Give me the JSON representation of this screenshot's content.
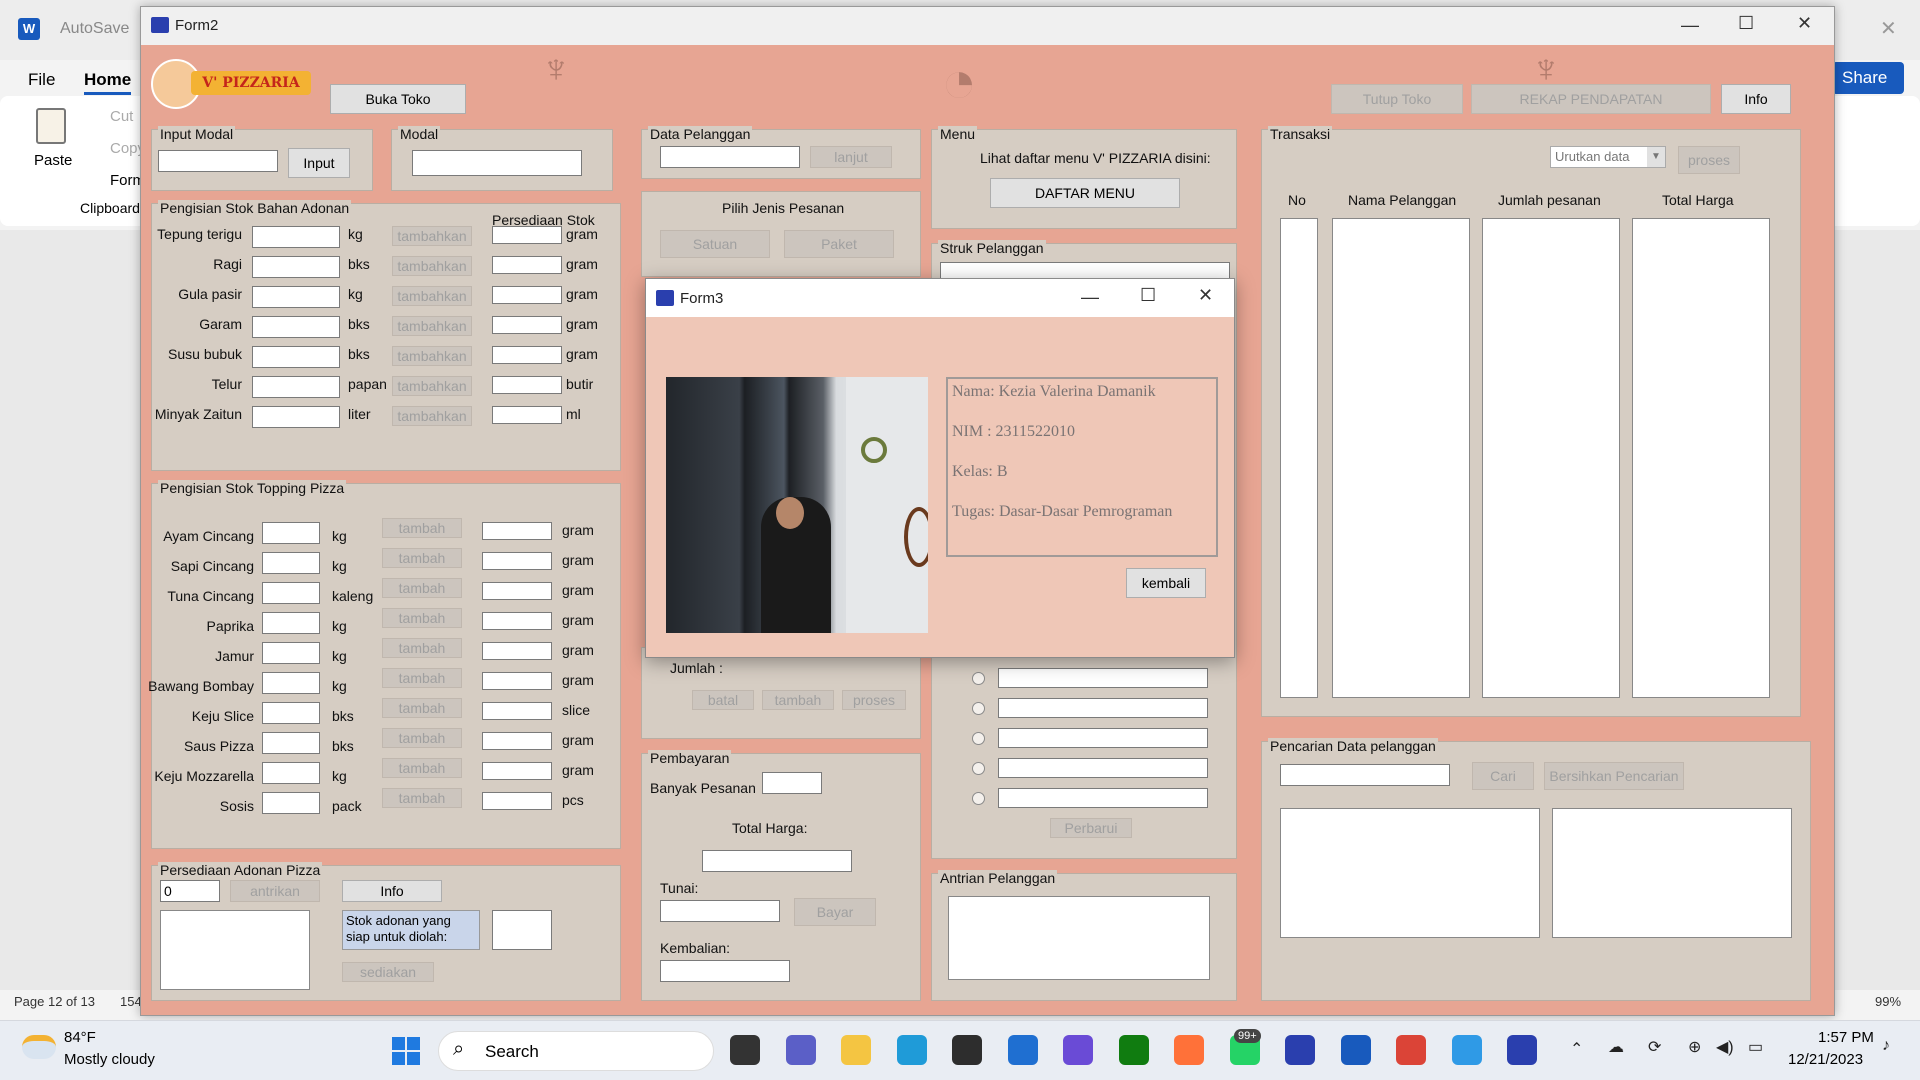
{
  "word": {
    "autosave_label": "AutoSave",
    "menu": [
      "File",
      "Home"
    ],
    "ribbon": {
      "paste": "Paste",
      "cut": "Cut",
      "copy": "Copy",
      "format": "Form",
      "group": "Clipboard"
    },
    "share": "Share",
    "status_page": "Page 12 of 13",
    "status_words": "154",
    "zoom": "99%"
  },
  "form2": {
    "title": "Form2",
    "logo_text": "V' PIZZARIA",
    "buttons": {
      "buka_toko": "Buka Toko",
      "tutup_toko": "Tutup Toko",
      "rekap": "REKAP PENDAPATAN",
      "info": "Info"
    },
    "input_modal": {
      "title": "Input Modal",
      "button": "Input"
    },
    "modal": {
      "title": "Modal"
    },
    "stok_adonan": {
      "title": "Pengisian Stok Bahan Adonan",
      "persediaan_header": "Persediaan Stok",
      "button": "tambahkan",
      "rows": [
        {
          "name": "Tepung terigu",
          "unit": "kg",
          "stock_unit": "gram"
        },
        {
          "name": "Ragi",
          "unit": "bks",
          "stock_unit": "gram"
        },
        {
          "name": "Gula pasir",
          "unit": "kg",
          "stock_unit": "gram"
        },
        {
          "name": "Garam",
          "unit": "bks",
          "stock_unit": "gram"
        },
        {
          "name": "Susu bubuk",
          "unit": "bks",
          "stock_unit": "gram"
        },
        {
          "name": "Telur",
          "unit": "papan",
          "stock_unit": "butir"
        },
        {
          "name": "Minyak Zaitun",
          "unit": "liter",
          "stock_unit": "ml"
        }
      ]
    },
    "stok_topping": {
      "title": "Pengisian Stok Topping Pizza",
      "button": "tambah",
      "rows": [
        {
          "name": "Ayam Cincang",
          "unit": "kg",
          "stock_unit": "gram"
        },
        {
          "name": "Sapi Cincang",
          "unit": "kg",
          "stock_unit": "gram"
        },
        {
          "name": "Tuna Cincang",
          "unit": "kaleng",
          "stock_unit": "gram"
        },
        {
          "name": "Paprika",
          "unit": "kg",
          "stock_unit": "gram"
        },
        {
          "name": "Jamur",
          "unit": "kg",
          "stock_unit": "gram"
        },
        {
          "name": "Bawang Bombay",
          "unit": "kg",
          "stock_unit": "gram"
        },
        {
          "name": "Keju Slice",
          "unit": "bks",
          "stock_unit": "slice"
        },
        {
          "name": "Saus Pizza",
          "unit": "bks",
          "stock_unit": "gram"
        },
        {
          "name": "Keju Mozzarella",
          "unit": "kg",
          "stock_unit": "gram"
        },
        {
          "name": "Sosis",
          "unit": "pack",
          "stock_unit": "pcs"
        }
      ]
    },
    "adonan": {
      "title": "Persediaan Adonan Pizza",
      "value": "0",
      "antrikan": "antrikan",
      "info": "Info",
      "stok_label": "Stok adonan yang siap untuk diolah:",
      "sediakan": "sediakan"
    },
    "data_pelanggan": {
      "title": "Data Pelanggan",
      "lanjut": "lanjut"
    },
    "jenis_pesanan": {
      "title": "Pilih Jenis Pesanan",
      "satuan": "Satuan",
      "paket": "Paket"
    },
    "jumlah": {
      "label": "Jumlah :",
      "batal": "batal",
      "tambah": "tambah",
      "proses": "proses"
    },
    "pembayaran": {
      "title": "Pembayaran",
      "banyak": "Banyak Pesanan",
      "total": "Total Harga:",
      "tunai": "Tunai:",
      "bayar": "Bayar",
      "kembalian": "Kembalian:"
    },
    "menu": {
      "title": "Menu",
      "text": "Lihat daftar menu V' PIZZARIA disini:",
      "button": "DAFTAR MENU"
    },
    "struk": {
      "title": "Struk Pelanggan",
      "perbarui": "Perbarui"
    },
    "antrian": {
      "title": "Antrian Pelanggan"
    },
    "transaksi": {
      "title": "Transaksi",
      "sort": "Urutkan data",
      "proses": "proses",
      "columns": [
        "No",
        "Nama Pelanggan",
        "Jumlah pesanan",
        "Total Harga"
      ]
    },
    "pencarian": {
      "title": "Pencarian Data pelanggan",
      "cari": "Cari",
      "bersihkan": "Bersihkan Pencarian"
    }
  },
  "form3": {
    "title": "Form3",
    "nama": "Nama: Kezia Valerina Damanik",
    "nim": "NIM  : 2311522010",
    "kelas": "Kelas: B",
    "tugas": "Tugas: Dasar-Dasar Pemrograman",
    "kembali": "kembali"
  },
  "taskbar": {
    "weather_temp": "84°F",
    "weather_desc": "Mostly cloudy",
    "search": "Search",
    "badge": "99+",
    "time": "1:57 PM",
    "date": "12/21/2023"
  },
  "colors": {
    "form_bg": "#e7a593",
    "panel": "#d6cdc3",
    "form3_bg": "#efc7b7",
    "word_blue": "#185abd"
  }
}
